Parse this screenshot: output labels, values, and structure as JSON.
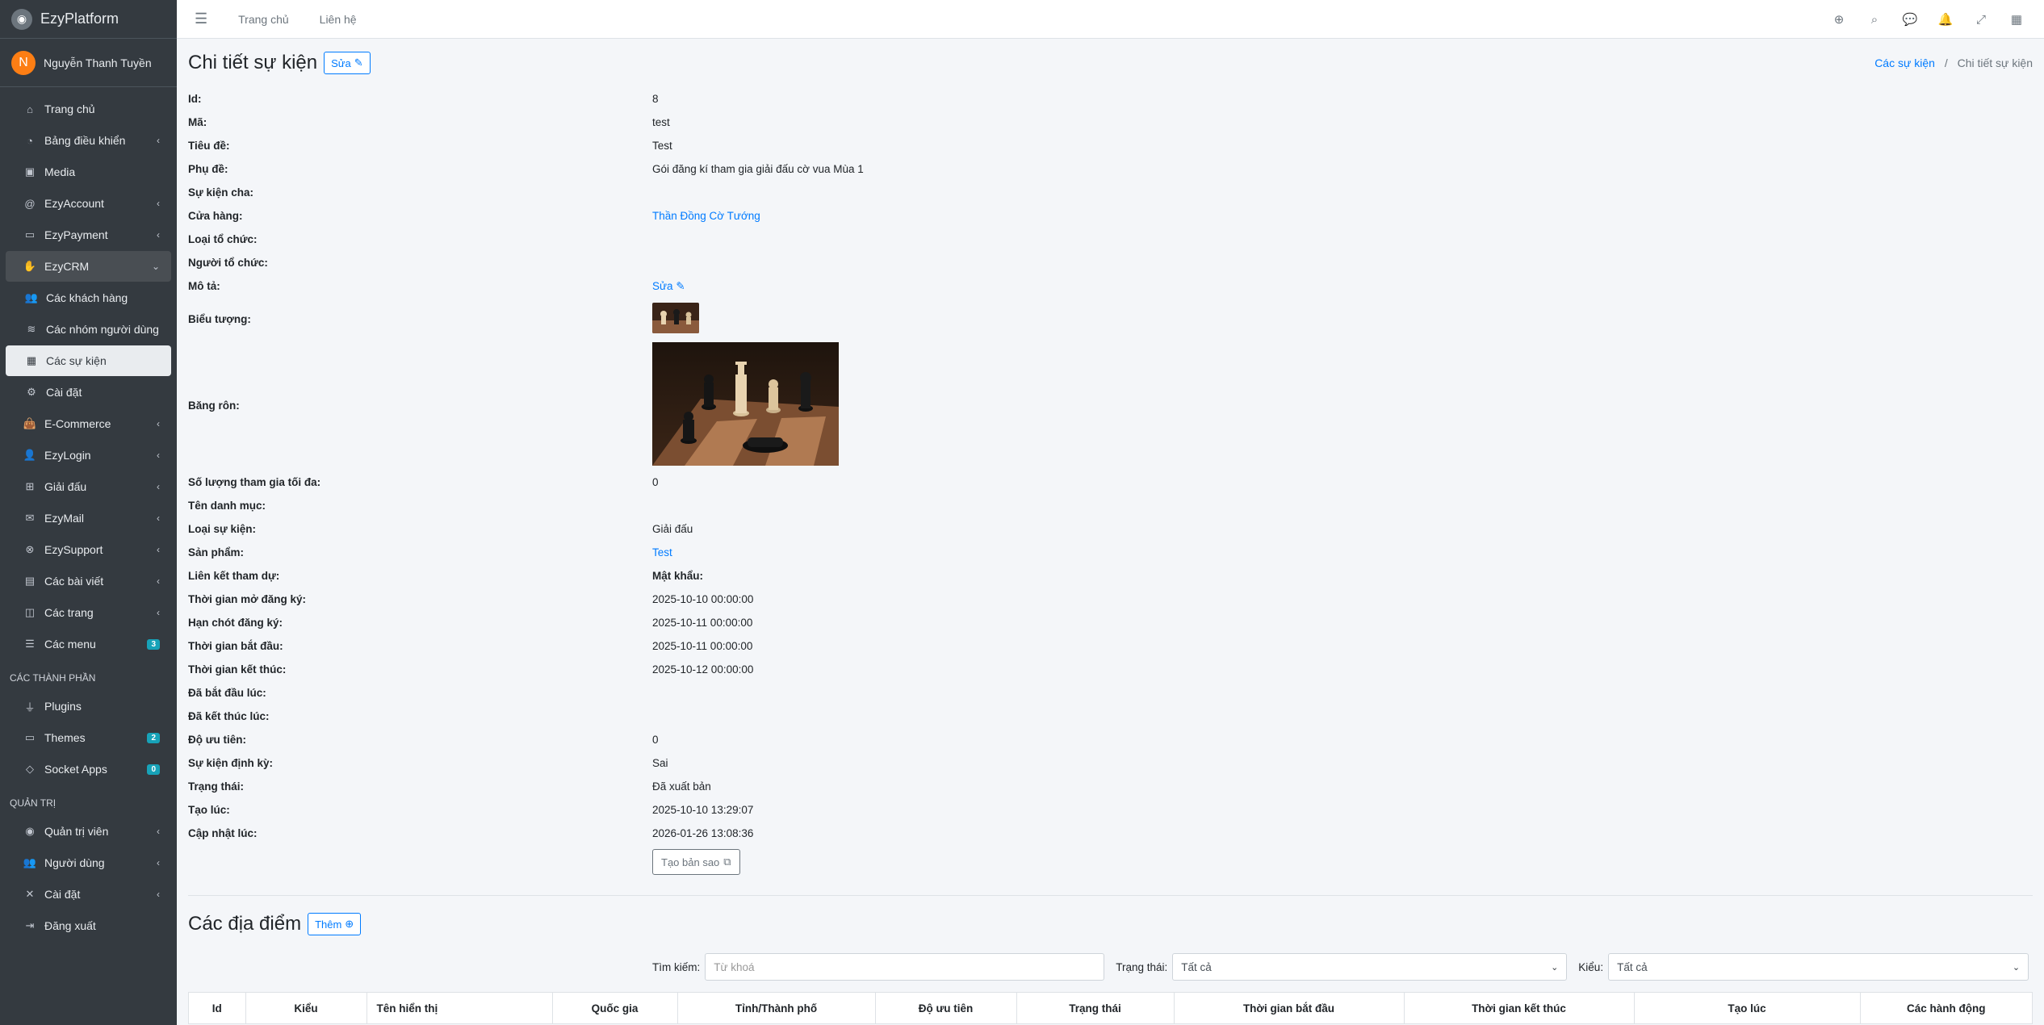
{
  "brand": {
    "name": "EzyPlatform"
  },
  "user": {
    "initial": "N",
    "name": "Nguyễn Thanh Tuyền"
  },
  "sidebar": {
    "items": [
      {
        "label": "Trang chủ"
      },
      {
        "label": "Bảng điều khiển"
      },
      {
        "label": "Media"
      },
      {
        "label": "EzyAccount"
      },
      {
        "label": "EzyPayment"
      },
      {
        "label": "EzyCRM"
      },
      {
        "label": "Các khách hàng"
      },
      {
        "label": "Các nhóm người dùng"
      },
      {
        "label": "Các sự kiện"
      },
      {
        "label": "Cài đặt"
      },
      {
        "label": "E-Commerce"
      },
      {
        "label": "EzyLogin"
      },
      {
        "label": "Giải đấu"
      },
      {
        "label": "EzyMail"
      },
      {
        "label": "EzySupport"
      },
      {
        "label": "Các bài viết"
      },
      {
        "label": "Các trang"
      },
      {
        "label": "Các menu",
        "badge": "3"
      }
    ],
    "header_components": "CÁC THÀNH PHẦN",
    "components": [
      {
        "label": "Plugins"
      },
      {
        "label": "Themes",
        "badge": "2"
      },
      {
        "label": "Socket Apps",
        "badge": "0"
      }
    ],
    "header_admin": "QUẢN TRỊ",
    "admin": [
      {
        "label": "Quản trị viên"
      },
      {
        "label": "Người dùng"
      },
      {
        "label": "Cài đặt"
      },
      {
        "label": "Đăng xuất"
      }
    ]
  },
  "topbar": {
    "home": "Trang chủ",
    "contact": "Liên hệ"
  },
  "page": {
    "title": "Chi tiết sự kiện",
    "edit_label": "Sửa",
    "breadcrumb": {
      "parent": "Các sự kiện",
      "sep": "/",
      "current": "Chi tiết sự kiện"
    }
  },
  "details": {
    "id": {
      "label": "Id:",
      "value": "8"
    },
    "code": {
      "label": "Mã:",
      "value": "test"
    },
    "title": {
      "label": "Tiêu đề:",
      "value": "Test"
    },
    "subtitle": {
      "label": "Phụ đề:",
      "value": "Gói đăng kí tham gia giải đấu cờ vua Mùa 1"
    },
    "parent_event": {
      "label": "Sự kiện cha:",
      "value": ""
    },
    "store": {
      "label": "Cửa hàng:",
      "value": "Thần Đồng Cờ Tướng"
    },
    "org_type": {
      "label": "Loại tổ chức:",
      "value": ""
    },
    "organizer": {
      "label": "Người tổ chức:",
      "value": ""
    },
    "description": {
      "label": "Mô tả:",
      "value": "Sửa"
    },
    "icon": {
      "label": "Biểu tượng:"
    },
    "banner": {
      "label": "Băng rôn:"
    },
    "max_participants": {
      "label": "Số lượng tham gia tối đa:",
      "value": "0"
    },
    "category": {
      "label": "Tên danh mục:",
      "value": ""
    },
    "event_type": {
      "label": "Loại sự kiện:",
      "value": "Giải đấu"
    },
    "product": {
      "label": "Sản phẩm:",
      "value": "Test"
    },
    "join_link": {
      "label": "Liên kết tham dự:",
      "value": "Mật khẩu:"
    },
    "reg_open": {
      "label": "Thời gian mở đăng ký:",
      "value": "2025-10-10 00:00:00"
    },
    "reg_deadline": {
      "label": "Hạn chót đăng ký:",
      "value": "2025-10-11 00:00:00"
    },
    "start_time": {
      "label": "Thời gian bắt đầu:",
      "value": "2025-10-11 00:00:00"
    },
    "end_time": {
      "label": "Thời gian kết thúc:",
      "value": "2025-10-12 00:00:00"
    },
    "started_at": {
      "label": "Đã bắt đầu lúc:",
      "value": ""
    },
    "ended_at": {
      "label": "Đã kết thúc lúc:",
      "value": ""
    },
    "priority": {
      "label": "Độ ưu tiên:",
      "value": "0"
    },
    "recurring": {
      "label": "Sự kiện định kỳ:",
      "value": "Sai"
    },
    "status": {
      "label": "Trạng thái:",
      "value": "Đã xuất bản"
    },
    "created_at": {
      "label": "Tạo lúc:",
      "value": "2025-10-10 13:29:07"
    },
    "updated_at": {
      "label": "Cập nhật lúc:",
      "value": "2026-01-26 13:08:36"
    },
    "clone_label": "Tạo bản sao"
  },
  "locations": {
    "title": "Các địa điểm",
    "add_label": "Thêm",
    "search_label": "Tìm kiếm:",
    "search_placeholder": "Từ khoá",
    "status_label": "Trạng thái:",
    "status_value": "Tất cả",
    "type_label": "Kiểu:",
    "type_value": "Tất cả",
    "columns": [
      "Id",
      "Kiểu",
      "Tên hiển thị",
      "Quốc gia",
      "Tỉnh/Thành phố",
      "Độ ưu tiên",
      "Trạng thái",
      "Thời gian bắt đầu",
      "Thời gian kết thúc",
      "Tạo lúc",
      "Các hành động"
    ]
  }
}
